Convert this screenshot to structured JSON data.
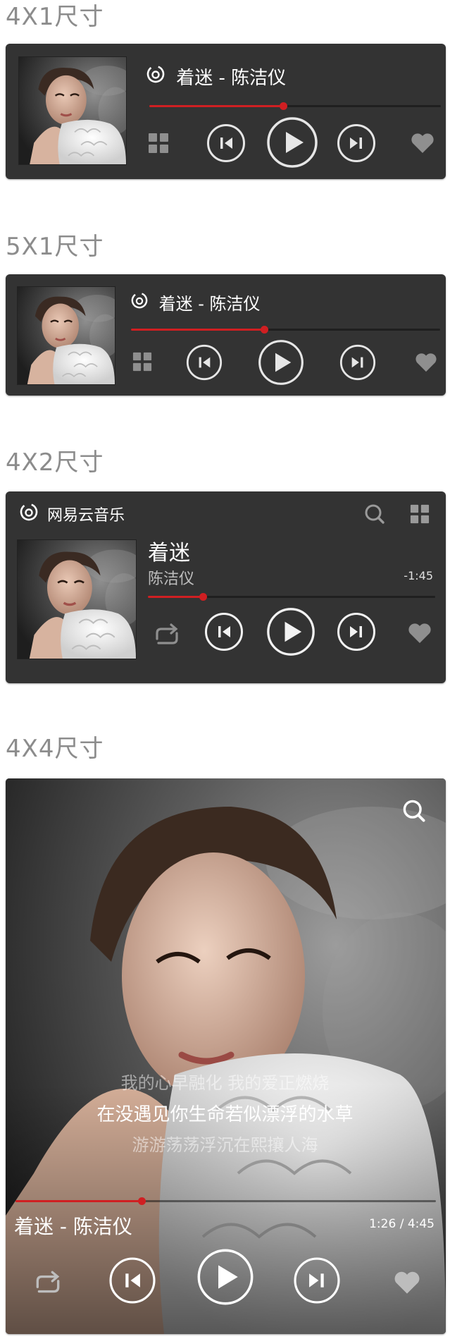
{
  "sections": {
    "s4x1": "4X1尺寸",
    "s5x1": "5X1尺寸",
    "s4x2": "4X2尺寸",
    "s4x4": "4X4尺寸"
  },
  "player": {
    "song_line": "着迷 - 陈洁仪",
    "song": "着迷",
    "artist": "陈洁仪",
    "brand": "网易云音乐",
    "remaining": "-1:45",
    "time_display": "1:26 / 4:45"
  },
  "progress": {
    "w4x1": 0.46,
    "w5x1": 0.43,
    "w4x2": 0.19,
    "w4x4": 0.3
  },
  "lyrics": {
    "prev": "我的心早融化 我的爱正燃烧",
    "current": "在没遇见你生命若似漂浮的水草",
    "next": "游游荡荡浮沉在熙攘人海"
  },
  "icons": [
    "netease-cloud-logo-icon",
    "grid-icon",
    "prev-icon",
    "play-icon",
    "next-icon",
    "heart-icon",
    "search-icon",
    "repeat-icon"
  ],
  "colors": {
    "accent": "#d01f22",
    "widget_bg": "#333333",
    "label": "#8c8c8c"
  }
}
